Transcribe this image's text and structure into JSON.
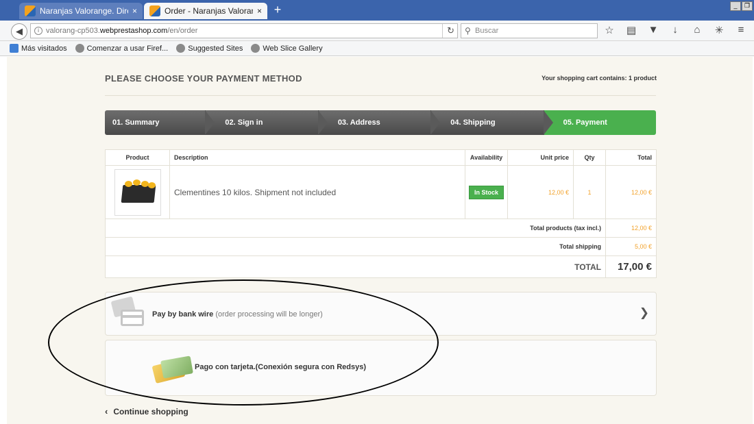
{
  "browser": {
    "tabs": [
      {
        "title": "Naranjas Valorange. Directas ...",
        "close": "×"
      },
      {
        "title": "Order - Naranjas Valorange. ...",
        "close": "×"
      }
    ],
    "new_tab": "+",
    "url_prefix": "valorang-cp503.",
    "url_domain": "webprestashop.com",
    "url_path": "/en/order",
    "search_placeholder": "Buscar",
    "bookmarks": [
      "Más visitados",
      "Comenzar a usar Firef...",
      "Suggested Sites",
      "Web Slice Gallery"
    ]
  },
  "page": {
    "heading": "PLEASE CHOOSE YOUR PAYMENT METHOD",
    "cart_info": "Your shopping cart contains: 1 product",
    "steps": [
      "01. Summary",
      "02. Sign in",
      "03. Address",
      "04. Shipping",
      "05. Payment"
    ],
    "table": {
      "headers": [
        "Product",
        "Description",
        "Availability",
        "Unit price",
        "Qty",
        "Total"
      ],
      "item": {
        "description": "Clementines 10 kilos. Shipment not included",
        "availability": "In Stock",
        "unit_price": "12,00 €",
        "qty": "1",
        "total": "12,00 €"
      },
      "total_products_label": "Total products (tax incl.)",
      "total_products": "12,00 €",
      "total_shipping_label": "Total shipping",
      "total_shipping": "5,00 €",
      "total_label": "TOTAL",
      "total": "17,00 €"
    },
    "payments": {
      "bank_wire_title": "Pay by bank wire",
      "bank_wire_note": "(order processing will be longer)",
      "card_title": "Pago con tarjeta.(Conexión segura con Redsys)"
    },
    "continue_shopping": "Continue shopping"
  },
  "colors": {
    "accent_green": "#4ab04e",
    "price_orange": "#f2a22b",
    "tabbar_blue": "#3b64ac"
  },
  "icons": [
    "back-arrow-icon",
    "info-icon",
    "reload-icon",
    "search-icon",
    "star-icon",
    "reading-list-icon",
    "pocket-icon",
    "download-icon",
    "home-icon",
    "chevron-right-icon",
    "chevron-left-icon",
    "bank-card-icon",
    "credit-cards-icon"
  ]
}
